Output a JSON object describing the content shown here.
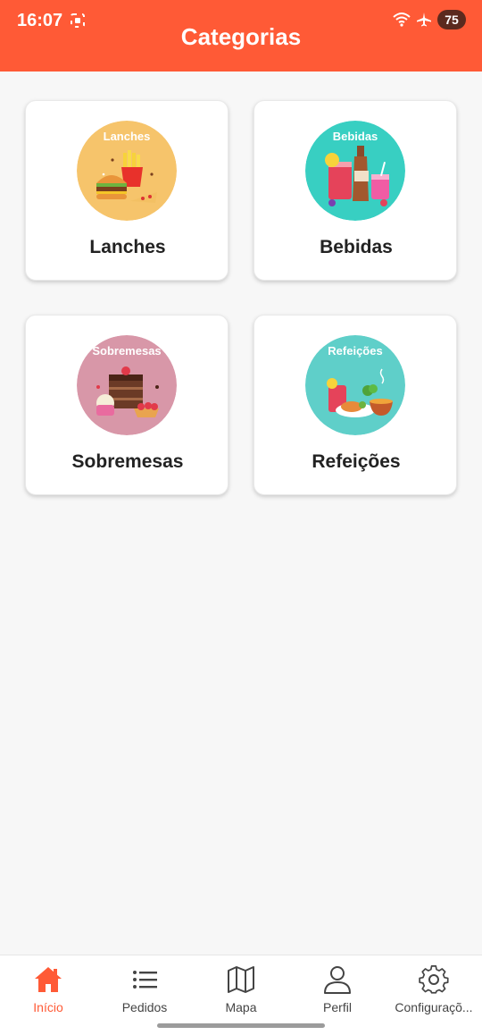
{
  "status_bar": {
    "time": "16:07",
    "battery": "75"
  },
  "header": {
    "title": "Categorias",
    "color": "#ff5a36"
  },
  "categories": [
    {
      "label": "Lanches",
      "circle_label": "Lanches",
      "bg": "#f6c46b",
      "icon": "burger-fries-icon"
    },
    {
      "label": "Bebidas",
      "circle_label": "Bebidas",
      "bg": "#38cfc2",
      "icon": "drinks-icon"
    },
    {
      "label": "Sobremesas",
      "circle_label": "Sobremesas",
      "bg": "#d897a8",
      "icon": "cake-dessert-icon"
    },
    {
      "label": "Refeições",
      "circle_label": "Refeições",
      "bg": "#5fcfc9",
      "icon": "meal-plate-icon"
    }
  ],
  "bottom_nav": {
    "items": [
      {
        "label": "Início",
        "icon": "home-icon",
        "active": true
      },
      {
        "label": "Pedidos",
        "icon": "list-icon",
        "active": false
      },
      {
        "label": "Mapa",
        "icon": "map-icon",
        "active": false
      },
      {
        "label": "Perfil",
        "icon": "user-icon",
        "active": false
      },
      {
        "label": "Configuraçõ...",
        "icon": "gear-icon",
        "active": false
      }
    ],
    "active_color": "#ff5a36"
  }
}
